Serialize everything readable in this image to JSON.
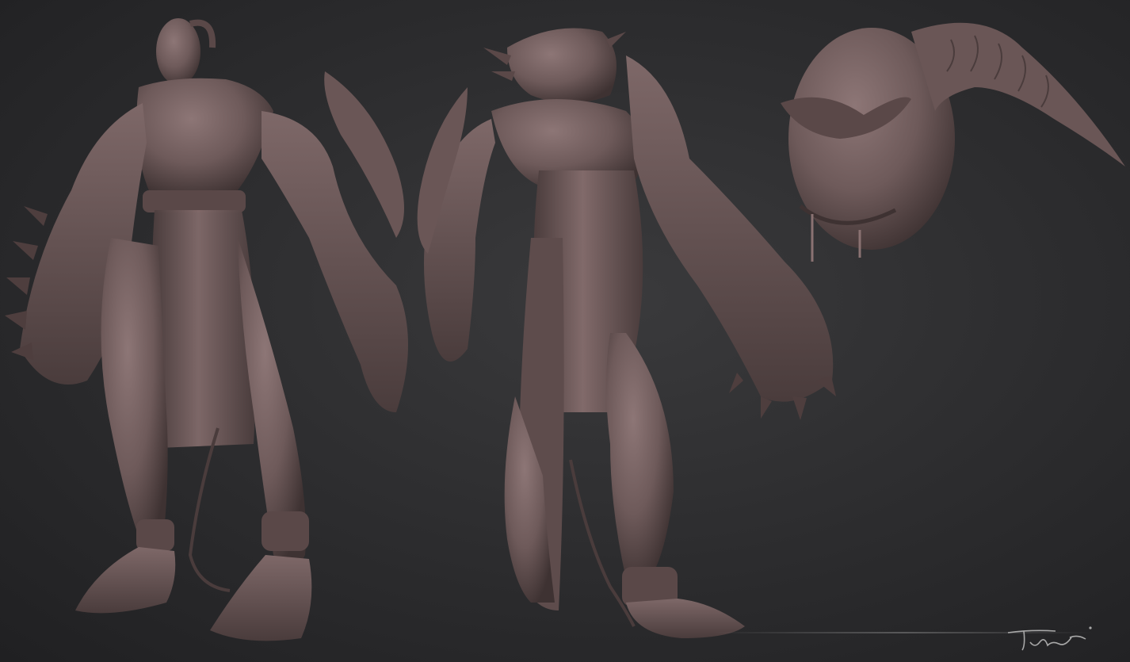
{
  "scene": {
    "views": [
      "front-three-quarter",
      "back-three-quarter",
      "head-detail"
    ],
    "palette": {
      "background": "#2e2e30",
      "clay_base": "#6e5a5a",
      "clay_light": "#8d7676",
      "clay_dark": "#3e3232"
    }
  },
  "signature": {
    "kind": "handwritten-signature"
  }
}
